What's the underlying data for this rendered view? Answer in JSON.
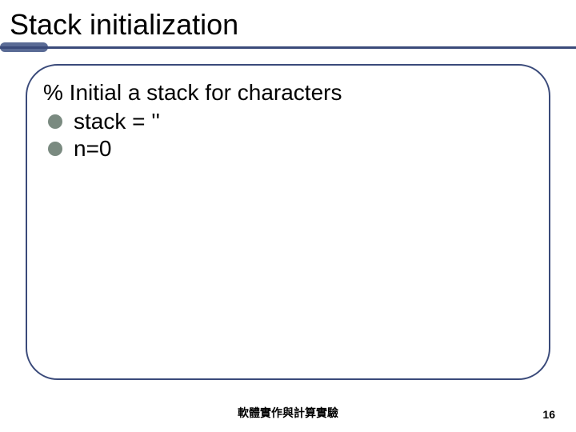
{
  "title": "Stack initialization",
  "content": {
    "comment": "% Initial a stack for characters",
    "bullets": [
      "stack = ''",
      "n=0"
    ]
  },
  "footer": "軟體實作與計算實驗",
  "page_number": "16"
}
